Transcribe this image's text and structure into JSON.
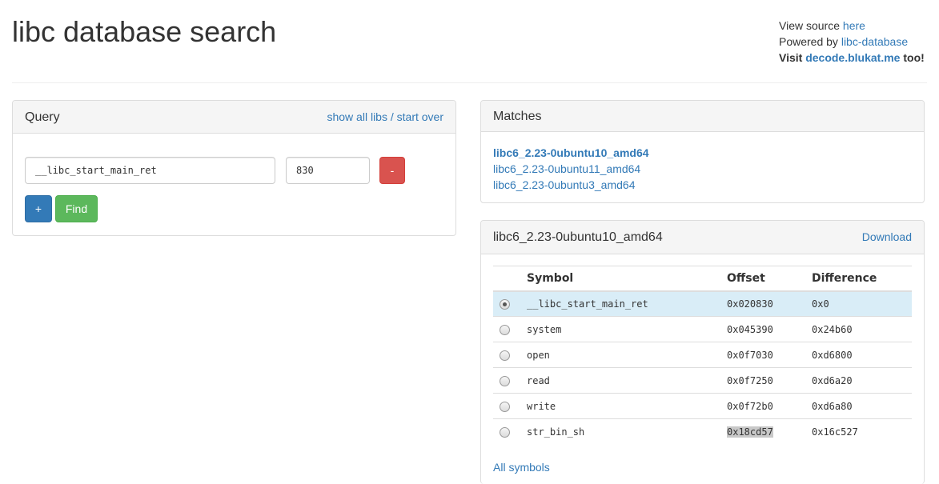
{
  "header": {
    "title": "libc database search",
    "view_source_prefix": "View source ",
    "view_source_link": "here",
    "powered_prefix": "Powered by ",
    "powered_link": "libc-database",
    "visit_prefix": "Visit ",
    "visit_link": "decode.blukat.me",
    "visit_suffix": " too!"
  },
  "query": {
    "title": "Query",
    "show_all_libs": "show all libs",
    "separator": " / ",
    "start_over": "start over",
    "symbol_value": "__libc_start_main_ret",
    "offset_value": "830",
    "remove_label": "-",
    "add_label": "+",
    "find_label": "Find"
  },
  "matches": {
    "title": "Matches",
    "items": [
      {
        "label": "libc6_2.23-0ubuntu10_amd64",
        "active": true
      },
      {
        "label": "libc6_2.23-0ubuntu11_amd64",
        "active": false
      },
      {
        "label": "libc6_2.23-0ubuntu3_amd64",
        "active": false
      }
    ]
  },
  "lib": {
    "title": "libc6_2.23-0ubuntu10_amd64",
    "download_label": "Download",
    "columns": [
      "Symbol",
      "Offset",
      "Difference"
    ],
    "rows": [
      {
        "symbol": "__libc_start_main_ret",
        "offset": "0x020830",
        "difference": "0x0",
        "selected": true
      },
      {
        "symbol": "system",
        "offset": "0x045390",
        "difference": "0x24b60",
        "selected": false
      },
      {
        "symbol": "open",
        "offset": "0x0f7030",
        "difference": "0xd6800",
        "selected": false
      },
      {
        "symbol": "read",
        "offset": "0x0f7250",
        "difference": "0xd6a20",
        "selected": false
      },
      {
        "symbol": "write",
        "offset": "0x0f72b0",
        "difference": "0xd6a80",
        "selected": false
      },
      {
        "symbol": "str_bin_sh",
        "offset": "0x18cd57",
        "difference": "0x16c527",
        "selected": false
      }
    ],
    "all_symbols_label": "All symbols"
  }
}
